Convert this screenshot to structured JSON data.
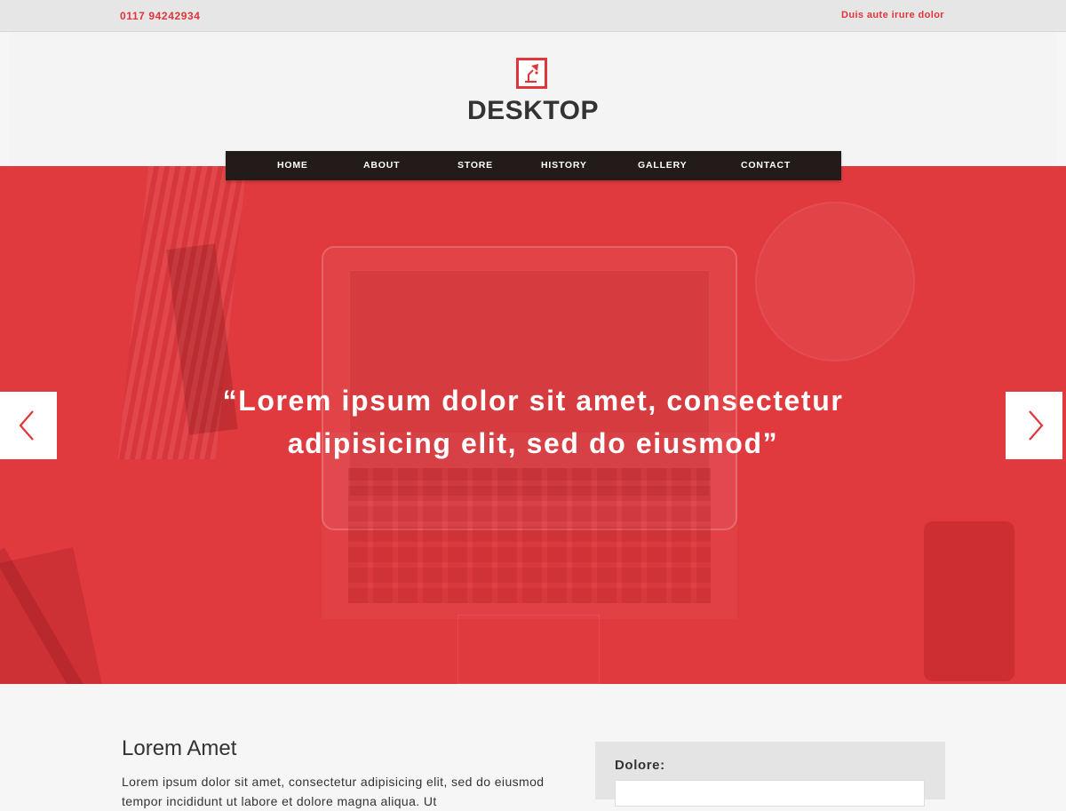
{
  "topbar": {
    "phone": "0117 94242934",
    "tagline": "Duis aute irure dolor"
  },
  "header": {
    "logo_icon": "desk-lamp-icon",
    "brand": "DESKTOP"
  },
  "nav": {
    "items": [
      {
        "label": "HOME"
      },
      {
        "label": "ABOUT"
      },
      {
        "label": "STORE"
      },
      {
        "label": "HISTORY"
      },
      {
        "label": "GALLERY"
      },
      {
        "label": "CONTACT"
      }
    ]
  },
  "hero": {
    "quote_line1": "“Lorem ipsum dolor sit amet, consectetur",
    "quote_line2": "adipisicing elit, sed do eiusmod”",
    "prev_icon": "chevron-left-icon",
    "next_icon": "chevron-right-icon",
    "accent_color": "#e0363b"
  },
  "content": {
    "title": "Lorem Amet",
    "text": "Lorem ipsum dolor sit amet, consectetur adipisicing elit, sed do eiusmod tempor incididunt ut labore et dolore magna aliqua. Ut"
  },
  "sidebar": {
    "label": "Dolore:",
    "input_value": ""
  }
}
